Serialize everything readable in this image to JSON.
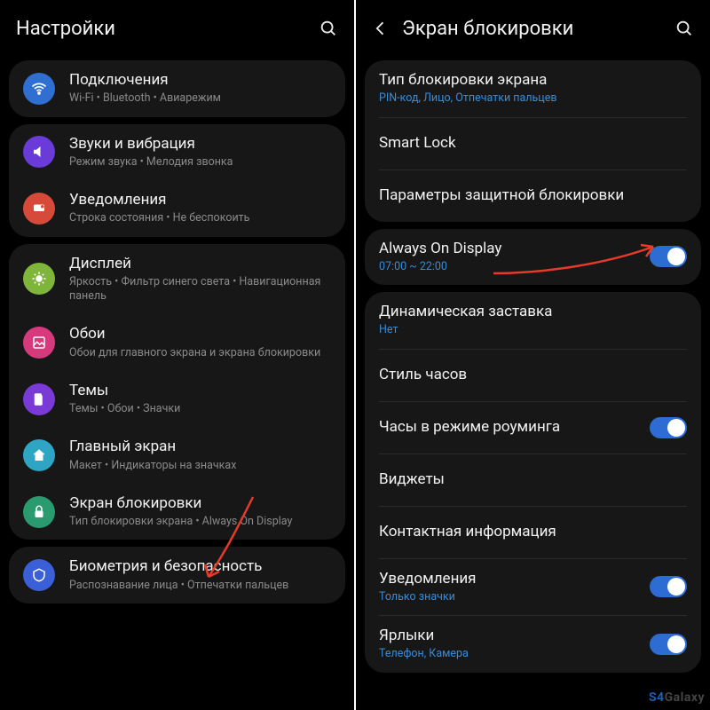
{
  "left": {
    "title": "Настройки",
    "groups": [
      [
        {
          "icon": "wifi-icon",
          "color": "#2f6fd1",
          "title": "Подключения",
          "sub": "Wi-Fi • Bluetooth • Авиарежим"
        }
      ],
      [
        {
          "icon": "sound-icon",
          "color": "#6a3bd6",
          "title": "Звуки и вибрация",
          "sub": "Режим звука • Мелодия звонка"
        },
        {
          "icon": "notification-icon",
          "color": "#d64a3a",
          "title": "Уведомления",
          "sub": "Строка состояния • Не беспокоить"
        }
      ],
      [
        {
          "icon": "display-icon",
          "color": "#7fb53a",
          "title": "Дисплей",
          "sub": "Яркость • Фильтр синего света • Навигационная панель"
        },
        {
          "icon": "wallpaper-icon",
          "color": "#d63a7d",
          "title": "Обои",
          "sub": "Обои для главного экрана и экрана блокировки"
        },
        {
          "icon": "themes-icon",
          "color": "#7a3ad6",
          "title": "Темы",
          "sub": "Темы • Обои • Значки"
        },
        {
          "icon": "home-icon",
          "color": "#2fa5c4",
          "title": "Главный экран",
          "sub": "Макет • Индикаторы на значках"
        },
        {
          "icon": "lock-icon",
          "color": "#2a9a6f",
          "title": "Экран блокировки",
          "sub": "Тип блокировки экрана • Always On Display"
        }
      ],
      [
        {
          "icon": "biometrics-icon",
          "color": "#3a5fd6",
          "title": "Биометрия и безопасность",
          "sub": "Распознавание лица • Отпечатки пальцев"
        }
      ]
    ]
  },
  "right": {
    "title": "Экран блокировки",
    "groups": [
      [
        {
          "title": "Тип блокировки экрана",
          "sub": "PIN-код, Лицо, Отпечатки пальцев",
          "subblue": true
        },
        {
          "title": "Smart Lock"
        },
        {
          "title": "Параметры защитной блокировки"
        }
      ],
      [
        {
          "title": "Always On Display",
          "sub": "07:00 ~ 22:00",
          "subblue": true,
          "toggle": true
        }
      ],
      [
        {
          "title": "Динамическая заставка",
          "sub": "Нет",
          "subblue": true
        },
        {
          "title": "Стиль часов"
        },
        {
          "title": "Часы в режиме роуминга",
          "toggle": true
        },
        {
          "title": "Виджеты"
        },
        {
          "title": "Контактная информация"
        },
        {
          "title": "Уведомления",
          "sub": "Только значки",
          "subblue": true,
          "toggle": true
        },
        {
          "title": "Ярлыки",
          "sub": "Телефон, Камера",
          "subblue": true,
          "toggle": true
        }
      ]
    ]
  },
  "watermark": {
    "a": "S4",
    "b": "Galaxy"
  }
}
